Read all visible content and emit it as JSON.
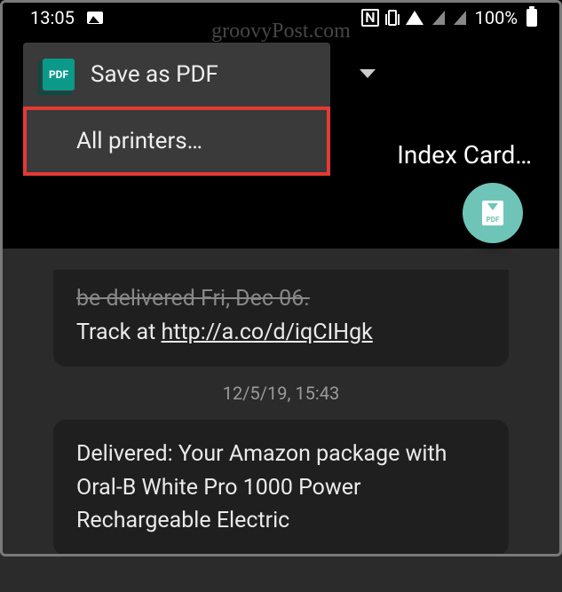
{
  "status": {
    "time": "13:05",
    "nfc_label": "N",
    "battery_pct": "100%"
  },
  "watermark": "groovyPost.com",
  "dropdown": {
    "pdf_icon_label": "PDF",
    "save_as_pdf": "Save as PDF",
    "all_printers": "All printers…"
  },
  "paper_size_label": "Index Card…",
  "fab": {
    "pdf_label": "PDF"
  },
  "messages": {
    "msg1_line1": "be delivered Fri, Dec 06.",
    "msg1_line2_prefix": "Track at ",
    "msg1_link": "http://a.co/d/iqCIHgk",
    "timestamp": "12/5/19, 15:43",
    "msg2": "Delivered: Your Amazon package with Oral-B White Pro 1000 Power Rechargeable Electric"
  }
}
